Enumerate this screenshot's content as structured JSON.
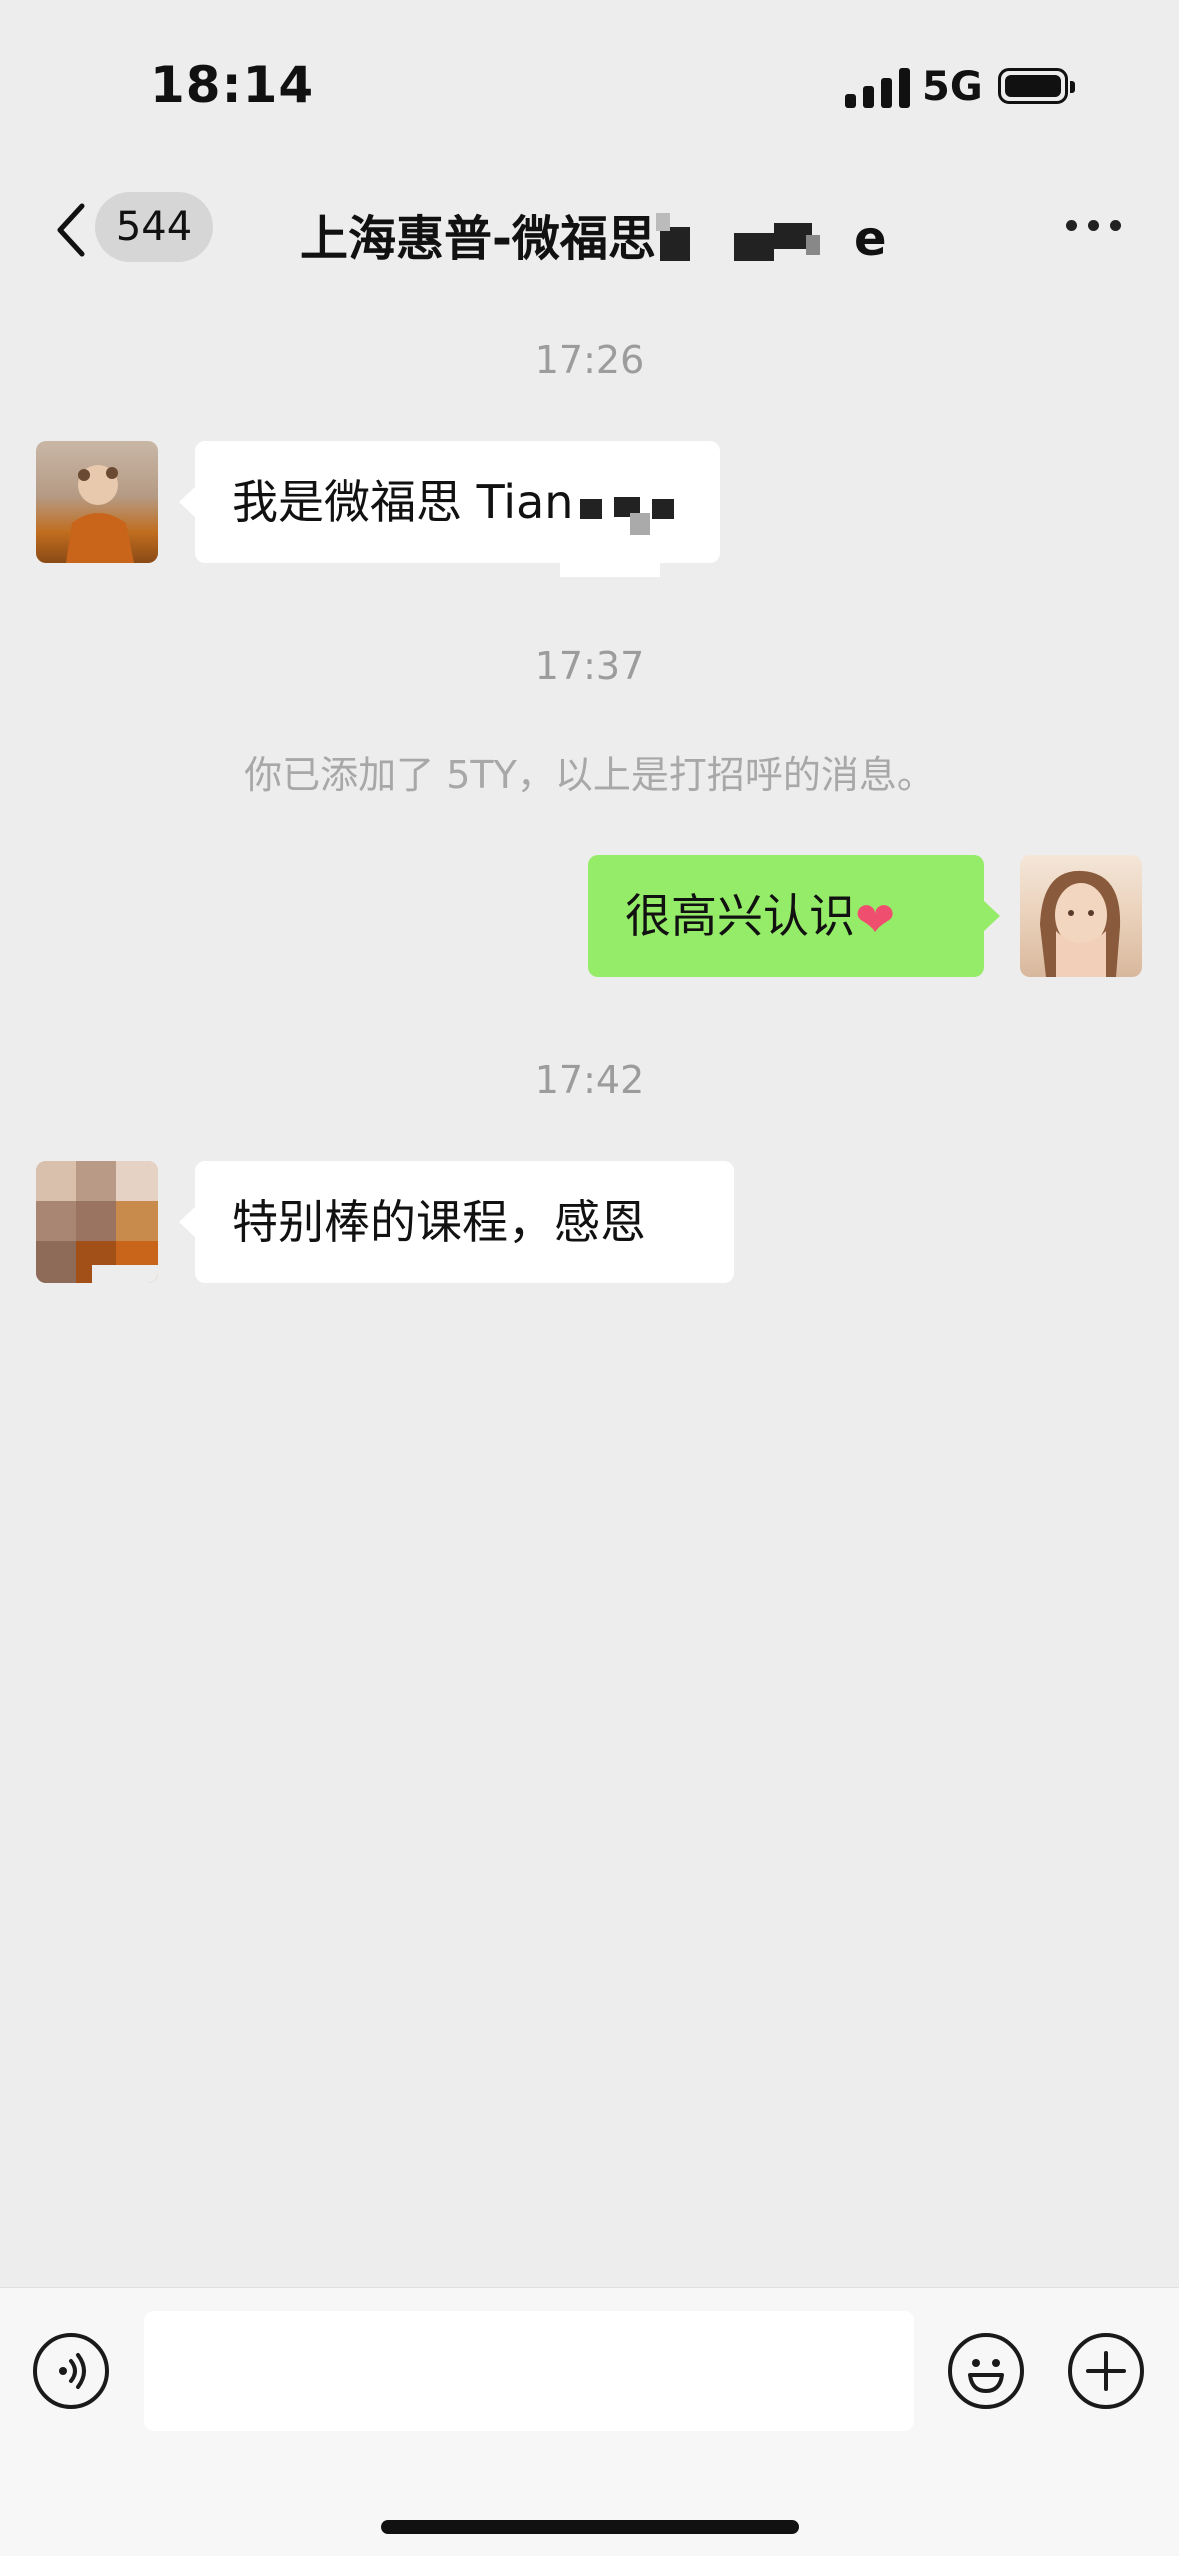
{
  "status_bar": {
    "time": "18:14",
    "network": "5G",
    "icons": [
      "signal-icon",
      "battery-icon"
    ]
  },
  "nav": {
    "back_icon": "chevron-left-icon",
    "unread_count": "544",
    "title": "上海惠普-微福思",
    "title_suffix": "e",
    "more_icon": "more-dots-icon"
  },
  "messages": [
    {
      "type": "timestamp",
      "text": "17:26"
    },
    {
      "type": "incoming",
      "text": "我是微福思 Tian"
    },
    {
      "type": "timestamp",
      "text": "17:37"
    },
    {
      "type": "system",
      "text": "你已添加了 5TY，以上是打招呼的消息。"
    },
    {
      "type": "outgoing",
      "text": "很高兴认识",
      "emoji": "❤"
    },
    {
      "type": "timestamp",
      "text": "17:42"
    },
    {
      "type": "incoming",
      "text": "特别棒的课程，感恩"
    }
  ],
  "input_bar": {
    "voice_icon": "voice-icon",
    "emoji_icon": "emoji-icon",
    "plus_icon": "plus-icon",
    "input_value": ""
  },
  "colors": {
    "background": "#ededed",
    "outgoing_bubble": "#95ec69",
    "incoming_bubble": "#ffffff",
    "timestamp_text": "#9c9c9c"
  }
}
